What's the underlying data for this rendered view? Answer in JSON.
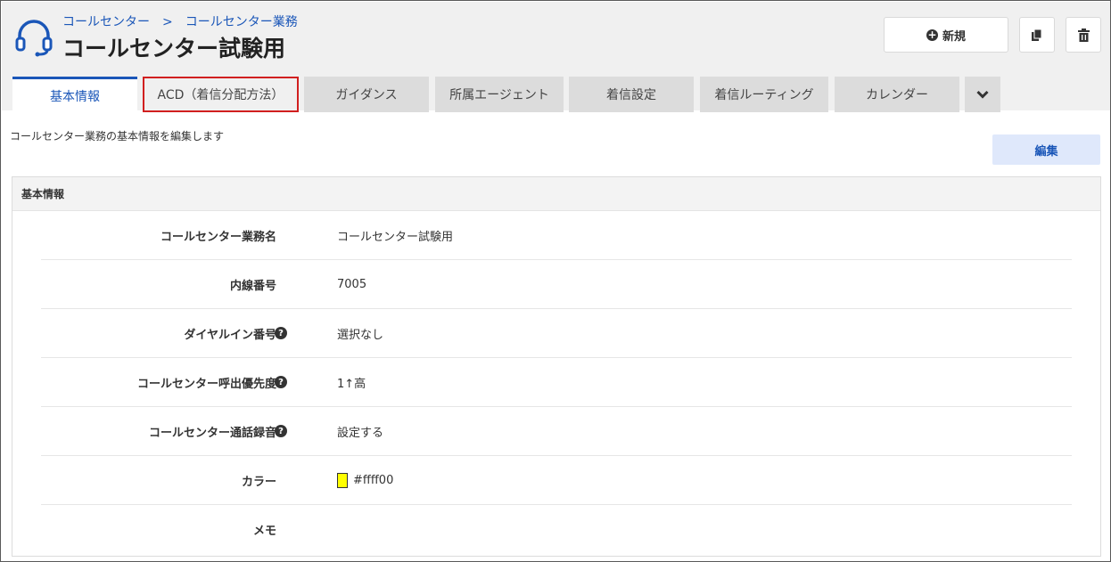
{
  "header": {
    "breadcrumb": [
      "コールセンター",
      "コールセンター業務"
    ],
    "breadcrumb_sep": ">",
    "title": "コールセンター試験用",
    "icon": "headset-icon",
    "new_button_label": "新規",
    "copy_icon": "copy-icon",
    "delete_icon": "trash-icon"
  },
  "tabs": [
    {
      "label": "基本情報",
      "active": true
    },
    {
      "label": "ACD（着信分配方法）",
      "highlight": true
    },
    {
      "label": "ガイダンス"
    },
    {
      "label": "所属エージェント"
    },
    {
      "label": "着信設定"
    },
    {
      "label": "着信ルーティング"
    },
    {
      "label": "カレンダー"
    }
  ],
  "more_tabs_icon": "chevron-down-icon",
  "description": "コールセンター業務の基本情報を編集します",
  "edit_button_label": "編集",
  "panel": {
    "title": "基本情報",
    "rows": [
      {
        "label": "コールセンター業務名",
        "value": "コールセンター試験用"
      },
      {
        "label": "内線番号",
        "value": "7005"
      },
      {
        "label": "ダイヤルイン番号",
        "value": "選択なし",
        "help": true
      },
      {
        "label": "コールセンター呼出優先度",
        "value": "1↑高",
        "help": true
      },
      {
        "label": "コールセンター通話録音",
        "value": "設定する",
        "help": true
      },
      {
        "label": "カラー",
        "value": "#ffff00",
        "swatch_color": "#ffff00"
      },
      {
        "label": "メモ",
        "value": ""
      }
    ]
  },
  "colors": {
    "accent": "#1a56b8",
    "highlight_border": "#d11f1f",
    "edit_button_bg": "#dfe8fb"
  }
}
